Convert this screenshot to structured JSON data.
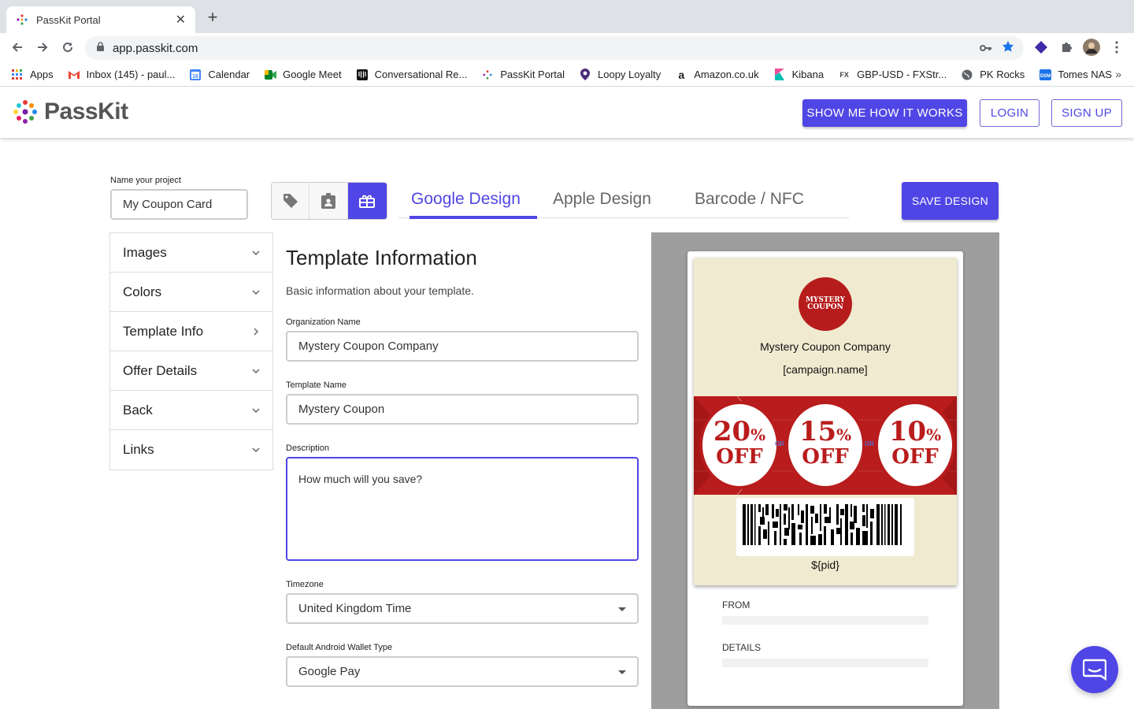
{
  "browser": {
    "tab_title": "PassKit Portal",
    "url": "app.passkit.com",
    "bookmarks": [
      {
        "label": "Apps",
        "icon": "apps-grid-icon"
      },
      {
        "label": "Inbox (145) - paul...",
        "icon": "gmail-icon"
      },
      {
        "label": "Calendar",
        "icon": "calendar-icon"
      },
      {
        "label": "Google Meet",
        "icon": "meet-icon"
      },
      {
        "label": "Conversational Re...",
        "icon": "intercom-icon"
      },
      {
        "label": "PassKit Portal",
        "icon": "passkit-icon"
      },
      {
        "label": "Loopy Loyalty",
        "icon": "location-pin-icon"
      },
      {
        "label": "Amazon.co.uk",
        "icon": "amazon-icon"
      },
      {
        "label": "Kibana",
        "icon": "kibana-icon"
      },
      {
        "label": "GBP-USD - FXStr...",
        "icon": "fx-icon"
      },
      {
        "label": "PK Rocks",
        "icon": "globe-icon"
      },
      {
        "label": "Tomes NAS",
        "icon": "nas-icon"
      }
    ],
    "bookmarks_more": "»"
  },
  "header": {
    "logo_text": "PassKit",
    "show_me_label": "SHOW ME HOW IT WORKS",
    "login_label": "LOGIN",
    "signup_label": "SIGN UP",
    "accent_color": "#5046e5"
  },
  "project": {
    "label": "Name your project",
    "value": "My Coupon Card"
  },
  "design_tabs": [
    {
      "label": "Google Design",
      "active": true
    },
    {
      "label": "Apple Design",
      "active": false
    },
    {
      "label": "Barcode / NFC",
      "active": false
    }
  ],
  "save_label": "SAVE DESIGN",
  "sidebar": {
    "items": [
      {
        "label": "Images",
        "chevron": "down"
      },
      {
        "label": "Colors",
        "chevron": "down"
      },
      {
        "label": "Template Info",
        "chevron": "right"
      },
      {
        "label": "Offer Details",
        "chevron": "down"
      },
      {
        "label": "Back",
        "chevron": "down"
      },
      {
        "label": "Links",
        "chevron": "down"
      }
    ]
  },
  "form": {
    "title": "Template Information",
    "subtitle": "Basic information about your template.",
    "org_label": "Organization Name",
    "org_value": "Mystery Coupon Company",
    "template_label": "Template Name",
    "template_value": "Mystery Coupon",
    "desc_label": "Description",
    "desc_value": "How much will you save?",
    "tz_label": "Timezone",
    "tz_value": "United Kingdom Time",
    "wallet_label": "Default Android Wallet Type",
    "wallet_value": "Google Pay"
  },
  "preview": {
    "logo_line1": "MYSTERY",
    "logo_line2": "COUPON",
    "org": "Mystery Coupon Company",
    "campaign": "[campaign.name]",
    "offers": [
      {
        "pct": "20",
        "sym": "%",
        "off": "OFF"
      },
      {
        "pct": "15",
        "sym": "%",
        "off": "OFF"
      },
      {
        "pct": "10",
        "sym": "%",
        "off": "OFF"
      }
    ],
    "or_text": "OR",
    "pid": "${pid}",
    "from_label": "FROM",
    "details_label": "DETAILS"
  }
}
